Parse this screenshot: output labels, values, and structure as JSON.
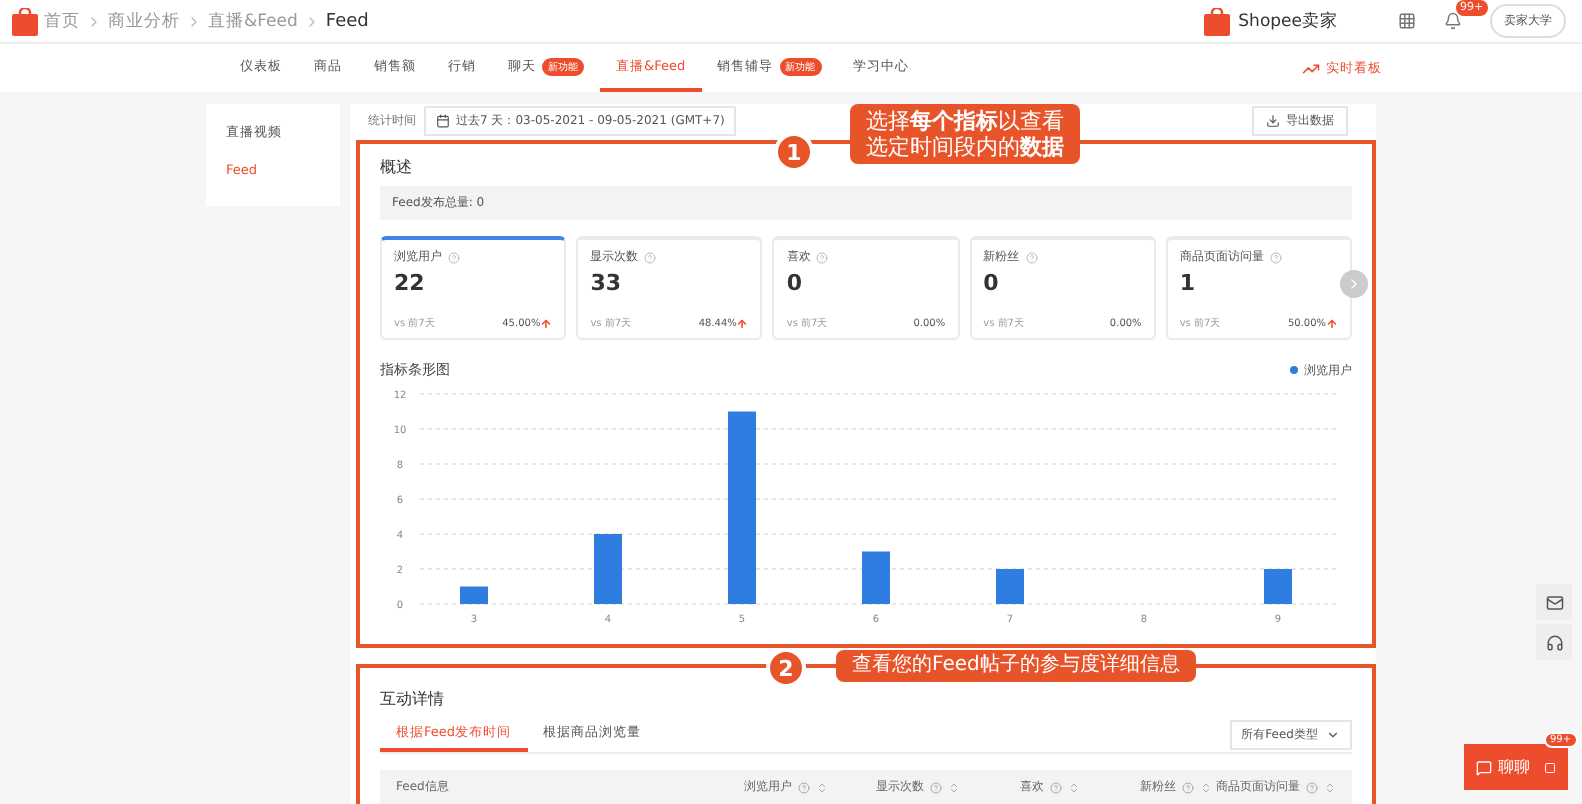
{
  "breadcrumb": [
    "首页",
    "商业分析",
    "直播&Feed",
    "Feed"
  ],
  "header": {
    "brand": "Shopee卖家",
    "notification_count": "99+",
    "university_button": "卖家大学"
  },
  "nav": {
    "tabs": [
      {
        "label": "仪表板",
        "selected": false
      },
      {
        "label": "商品",
        "selected": false
      },
      {
        "label": "销售额",
        "selected": false
      },
      {
        "label": "行销",
        "selected": false
      },
      {
        "label": "聊天",
        "badge": "新功能",
        "selected": false
      },
      {
        "label": "直播&Feed",
        "selected": true
      },
      {
        "label": "销售辅导",
        "badge": "新功能",
        "selected": false
      },
      {
        "label": "学习中心",
        "selected": false
      }
    ],
    "realtime_link": "实时看板"
  },
  "sidebar": {
    "items": [
      {
        "label": "直播视频",
        "selected": false
      },
      {
        "label": "Feed",
        "selected": true
      }
    ]
  },
  "filter": {
    "label": "统计时间",
    "date_range": "过去7 天：03-05-2021 - 09-05-2021 (GMT+7)",
    "export_button": "导出数据"
  },
  "overview": {
    "title": "概述",
    "total": "Feed发布总量: 0",
    "cards": [
      {
        "label": "浏览用户",
        "value": "22",
        "compare": "vs 前7天",
        "change": "45.00%",
        "rising": true,
        "selected": true
      },
      {
        "label": "显示次数",
        "value": "33",
        "compare": "vs 前7天",
        "change": "48.44%",
        "rising": true,
        "selected": false
      },
      {
        "label": "喜欢",
        "value": "0",
        "compare": "vs 前7天",
        "change": "0.00%",
        "rising": false,
        "selected": false
      },
      {
        "label": "新粉丝",
        "value": "0",
        "compare": "vs 前7天",
        "change": "0.00%",
        "rising": false,
        "selected": false
      },
      {
        "label": "商品页面访问量",
        "value": "1",
        "compare": "vs 前7天",
        "change": "50.00%",
        "rising": true,
        "selected": false
      }
    ],
    "chart_title": "指标条形图",
    "chart_data": {
      "type": "bar",
      "categories": [
        "3",
        "4",
        "5",
        "6",
        "7",
        "8",
        "9"
      ],
      "series": [
        {
          "name": "浏览用户",
          "color": "#2f7de1",
          "values": [
            1,
            4,
            11,
            3,
            2,
            0,
            2
          ]
        }
      ],
      "yticks": [
        0,
        2,
        4,
        6,
        8,
        10,
        12
      ],
      "ylim": [
        0,
        12
      ],
      "grid": true
    }
  },
  "details": {
    "title": "互动详情",
    "tabs": [
      {
        "label": "根据Feed发布时间",
        "selected": true
      },
      {
        "label": "根据商品浏览量",
        "selected": false
      }
    ],
    "type_select": "所有Feed类型",
    "columns": [
      "Feed信息",
      "浏览用户",
      "显示次数",
      "喜欢",
      "新粉丝",
      "商品页面访问量"
    ]
  },
  "callouts": [
    {
      "number": "1",
      "lines": [
        "选择**每个指标**以查看",
        "选定时间段内的**数据**"
      ]
    },
    {
      "number": "2",
      "lines": [
        "查看您的Feed帖子的参与度详细信息"
      ]
    }
  ],
  "chat": {
    "label": "聊聊",
    "count": "99+"
  }
}
